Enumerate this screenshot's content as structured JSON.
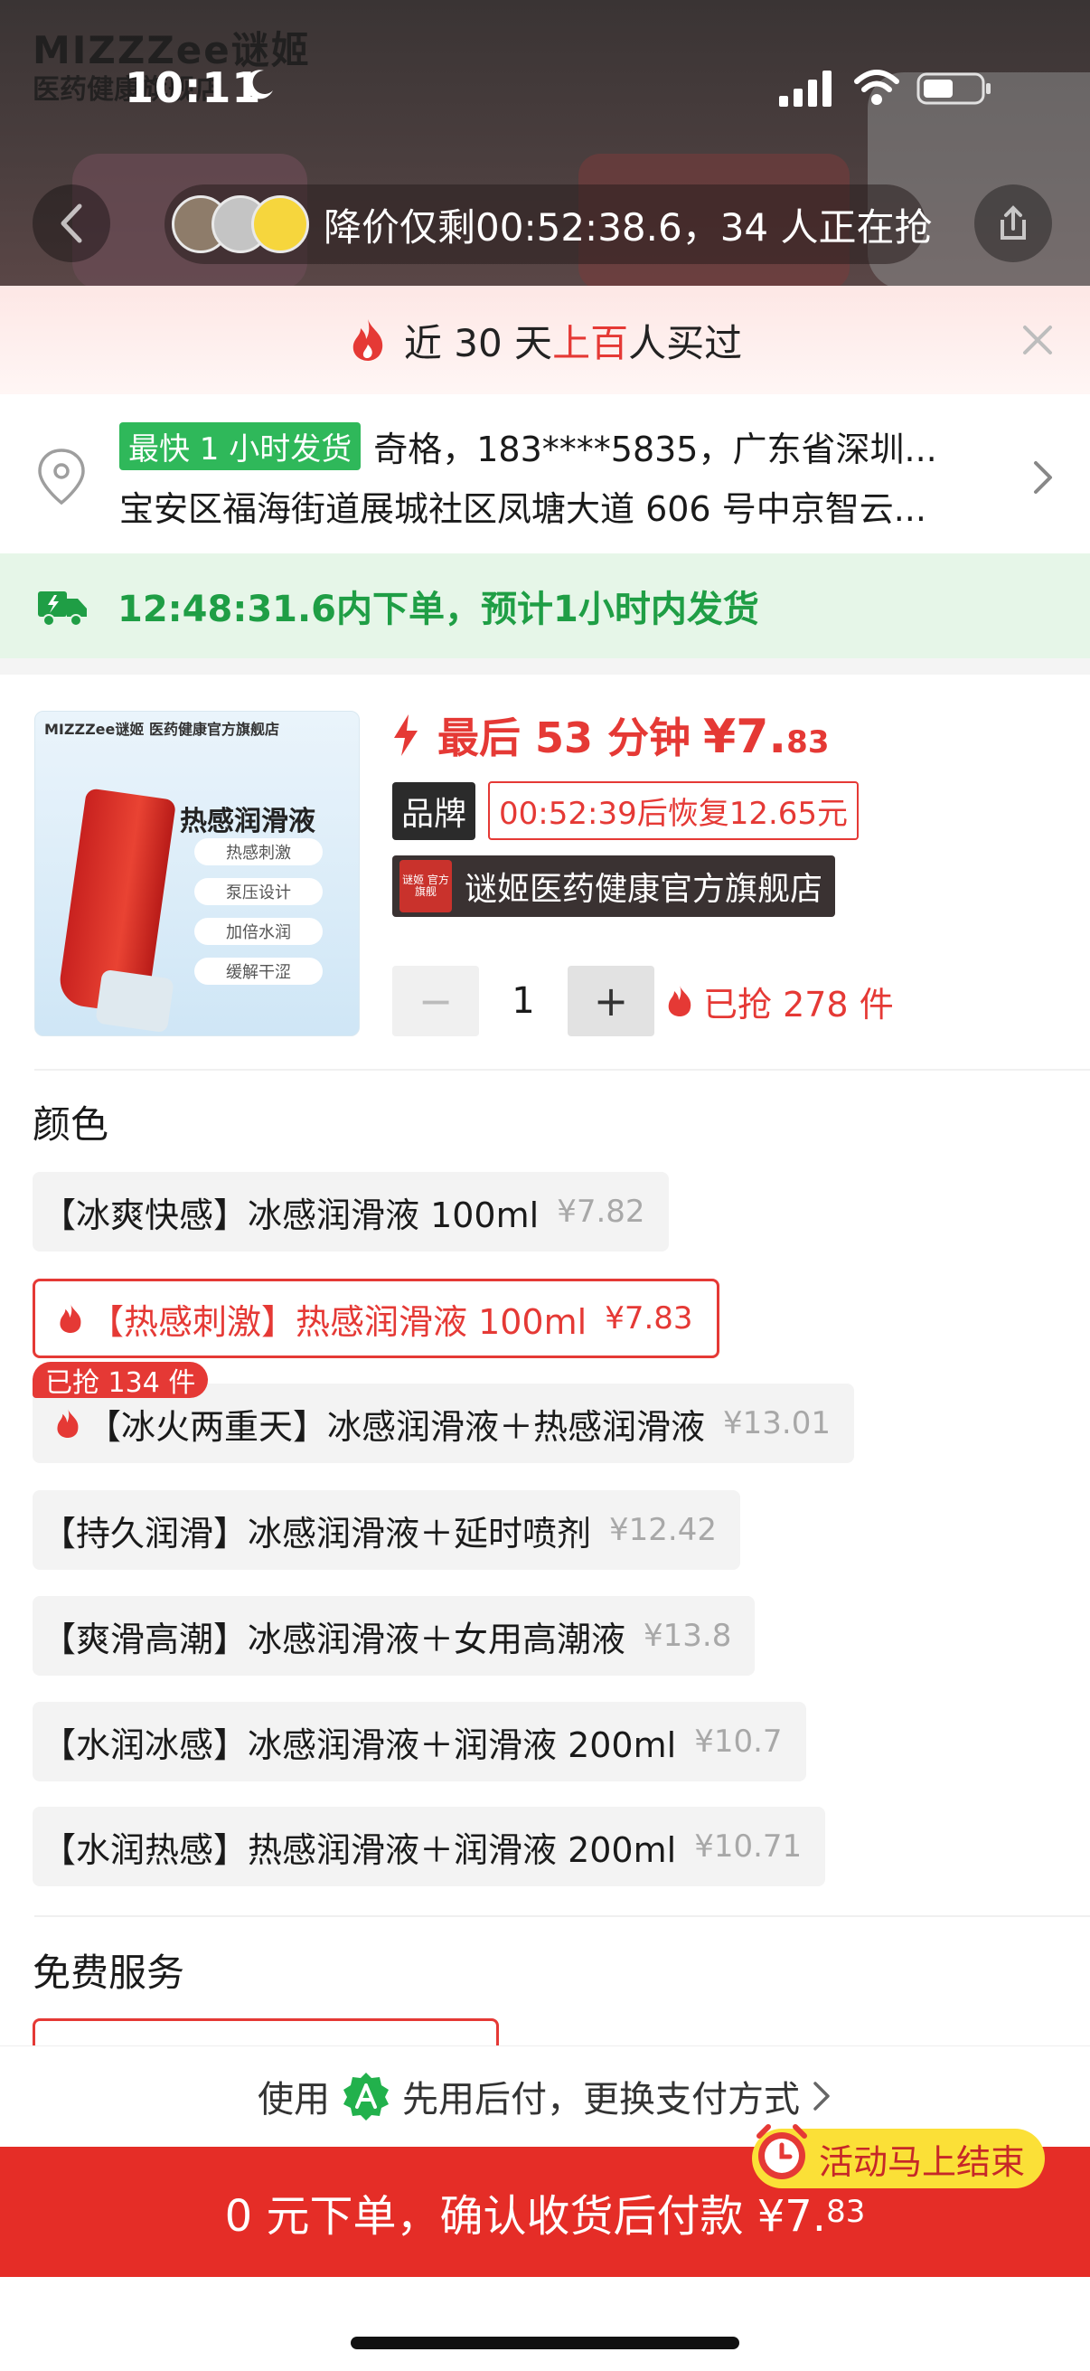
{
  "brand": {
    "logo_text": "MIZZZee谜姬",
    "logo_sub": "医药健康旗舰店"
  },
  "status_bar": {
    "time": "10:11"
  },
  "header": {
    "countdown_text": "降价仅剩00:52:38.6，34 人正在抢"
  },
  "social_proof": {
    "prefix": "近 30 天",
    "highlight": "上百",
    "suffix": "人买过"
  },
  "address": {
    "fast_tag": "最快 1 小时发货",
    "line1": "奇格，183****5835，广东省深圳...",
    "line2": "宝安区福海街道展城社区凤塘大道 606 号中京智云..."
  },
  "delivery": {
    "text": "12:48:31.6内下单，预计1小时内发货"
  },
  "product": {
    "image": {
      "header": "MIZZZee谜姬 医药健康官方旗舰店",
      "title": "热感润滑液",
      "features": [
        "热感刺激",
        "泵压设计",
        "加倍水润",
        "缓解干涩"
      ]
    },
    "price_prefix": "最后 53 分钟",
    "price_main": "¥7.",
    "price_dec": "83",
    "brand_badge": "品牌",
    "restore_tag": "00:52:39后恢复12.65元",
    "store_logo": "谜姬 官方旗舰",
    "store_name": "谜姬医药健康官方旗舰店",
    "qty_minus": "−",
    "qty_value": "1",
    "qty_plus": "+",
    "sold": "已抢 278 件"
  },
  "colors_section": {
    "title": "颜色",
    "variants": [
      {
        "name": "【冰爽快感】冰感润滑液 100ml",
        "price": "¥7.82"
      },
      {
        "name": "【热感刺激】热感润滑液 100ml",
        "price": "¥7.83"
      },
      {
        "name": "【冰火两重天】冰感润滑液＋热感润滑液",
        "price": "¥13.01"
      },
      {
        "name": "【持久润滑】冰感润滑液＋延时喷剂",
        "price": "¥12.42"
      },
      {
        "name": "【爽滑高潮】冰感润滑液＋女用高潮液",
        "price": "¥13.8"
      },
      {
        "name": "【水润冰感】冰感润滑液＋润滑液 200ml",
        "price": "¥10.7"
      },
      {
        "name": "【水润热感】热感润滑液＋润滑液 200ml",
        "price": "¥10.71"
      }
    ],
    "sold_badge": "已抢 134 件"
  },
  "services_section": {
    "title": "免费服务"
  },
  "payment": {
    "prefix": "使用",
    "method": "先用后付，更换支付方式"
  },
  "activity_tag": "活动马上结束",
  "buy_button": {
    "main": "0 元下单，确认收货后付款 ¥7.",
    "dec": "83"
  },
  "colors": {
    "accent": "#e53935",
    "green": "#1f9e45",
    "buy": "#e52d27",
    "activity": "#fbe037"
  }
}
